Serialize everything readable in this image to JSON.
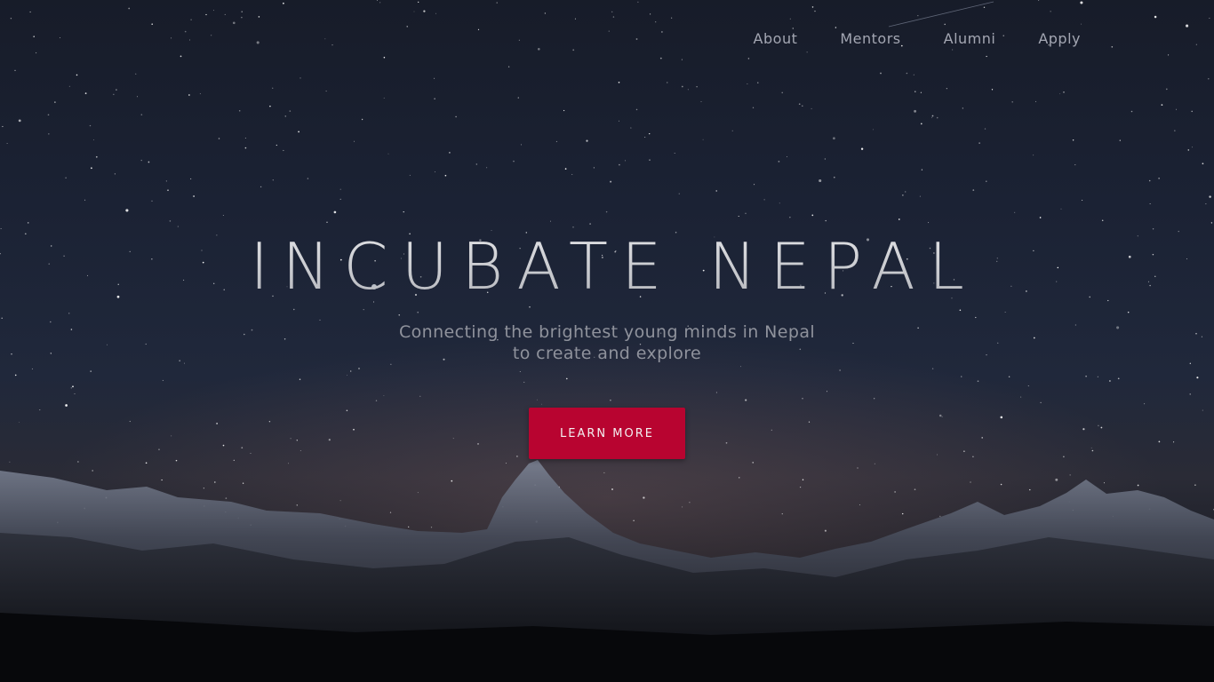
{
  "nav": {
    "items": [
      {
        "label": "About"
      },
      {
        "label": "Mentors"
      },
      {
        "label": "Alumni"
      },
      {
        "label": "Apply"
      }
    ]
  },
  "hero": {
    "title": "INCUBATE NEPAL",
    "subtitle_line1": "Connecting the brightest young minds in Nepal",
    "subtitle_line2": "to create and explore",
    "cta_label": "LEARN MORE"
  },
  "colors": {
    "accent": "#b80430",
    "nav_text": "#a3a6b2",
    "sky_top": "#171c29",
    "sky_horizon": "#2a2b36"
  }
}
